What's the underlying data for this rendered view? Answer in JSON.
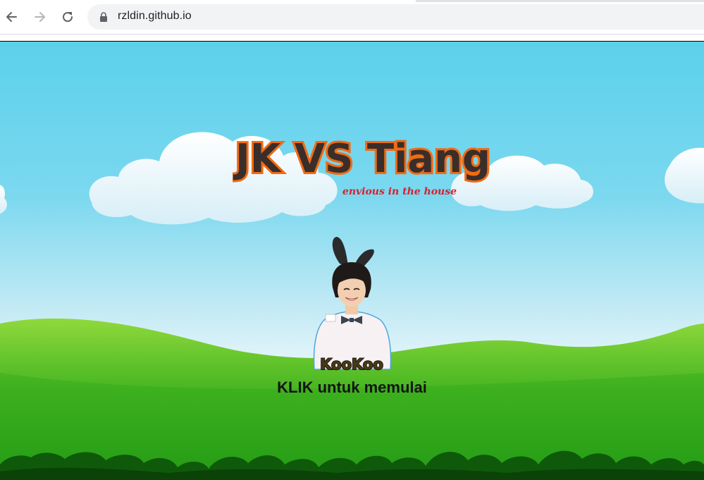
{
  "browser": {
    "url": "rzldin.github.io",
    "icons": [
      "back-arrow-icon",
      "forward-arrow-icon",
      "reload-icon",
      "lock-icon"
    ]
  },
  "game": {
    "title": "JK VS Tiang",
    "subtitle": "envious in the house",
    "character_name": "KooKoo",
    "start_prompt": "KLIK untuk memulai"
  },
  "colors": {
    "sky_top": "#5cd1eb",
    "hill_green": "#3fb51e",
    "bush_dark": "#0f5a0a",
    "title_fill": "#3a2e2a",
    "title_outline": "#f26a12",
    "subtitle_red": "#d8212e"
  }
}
